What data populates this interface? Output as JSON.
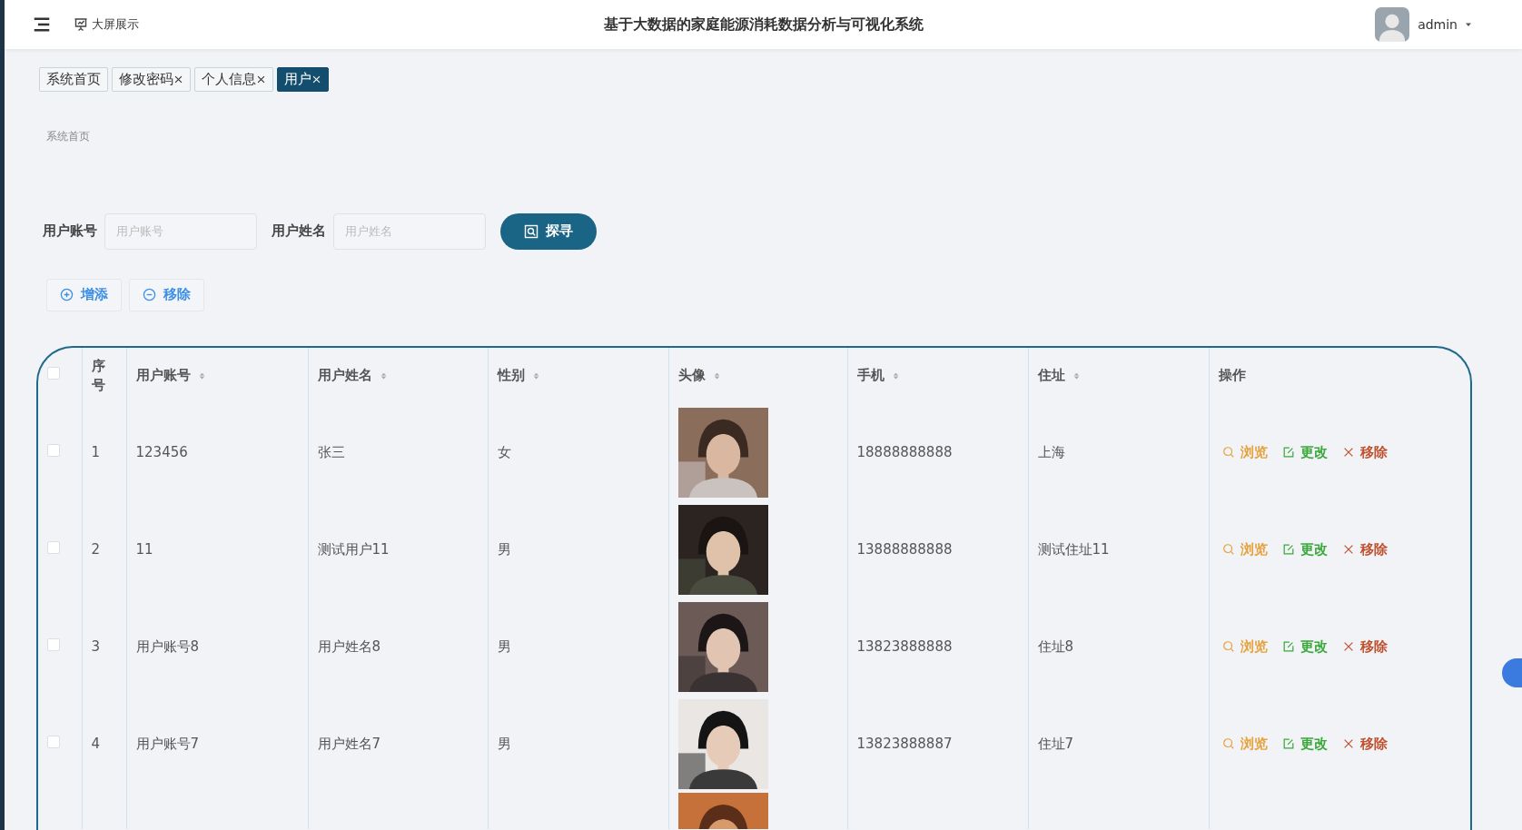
{
  "header": {
    "screen_link": "大屏展示",
    "title": "基于大数据的家庭能源消耗数据分析与可视化系统",
    "user": "admin"
  },
  "tabs": [
    {
      "label": "系统首页",
      "closable": false,
      "selected": false
    },
    {
      "label": "修改密码",
      "closable": true,
      "selected": false
    },
    {
      "label": "个人信息",
      "closable": true,
      "selected": false
    },
    {
      "label": "用户",
      "closable": true,
      "selected": true
    }
  ],
  "breadcrumb": "系统首页",
  "search": {
    "fields": [
      {
        "label": "用户账号",
        "placeholder": "用户账号"
      },
      {
        "label": "用户姓名",
        "placeholder": "用户姓名"
      }
    ],
    "button": "探寻"
  },
  "toolbar": [
    {
      "kind": "add",
      "label": "增添"
    },
    {
      "kind": "remove",
      "label": "移除"
    }
  ],
  "table": {
    "select_all_checked": false,
    "columns": [
      {
        "label": "序号",
        "sortable": false
      },
      {
        "label": "用户账号",
        "sortable": true
      },
      {
        "label": "用户姓名",
        "sortable": true
      },
      {
        "label": "性别",
        "sortable": true
      },
      {
        "label": "头像",
        "sortable": true
      },
      {
        "label": "手机",
        "sortable": true
      },
      {
        "label": "住址",
        "sortable": true
      },
      {
        "label": "操作",
        "sortable": false
      }
    ],
    "rows": [
      {
        "index": "1",
        "account": "123456",
        "name": "张三",
        "gender": "女",
        "avatar": {
          "kind": "picture"
        },
        "phone": "18888888888",
        "address": "上海",
        "checked": false,
        "actions": [
          {
            "kind": "view",
            "label": "浏览"
          },
          {
            "kind": "edit",
            "label": "更改"
          },
          {
            "kind": "delete",
            "label": "移除"
          }
        ]
      },
      {
        "index": "2",
        "account": "11",
        "name": "测试用户11",
        "gender": "男",
        "avatar": {
          "kind": "picture"
        },
        "phone": "13888888888",
        "address": "测试住址11",
        "checked": false,
        "actions": [
          {
            "kind": "view",
            "label": "浏览"
          },
          {
            "kind": "edit",
            "label": "更改"
          },
          {
            "kind": "delete",
            "label": "移除"
          }
        ]
      },
      {
        "index": "3",
        "account": "用户账号8",
        "name": "用户姓名8",
        "gender": "男",
        "avatar": {
          "kind": "picture"
        },
        "phone": "13823888888",
        "address": "住址8",
        "checked": false,
        "actions": [
          {
            "kind": "view",
            "label": "浏览"
          },
          {
            "kind": "edit",
            "label": "更改"
          },
          {
            "kind": "delete",
            "label": "移除"
          }
        ]
      },
      {
        "index": "4",
        "account": "用户账号7",
        "name": "用户姓名7",
        "gender": "男",
        "avatar": {
          "kind": "picture"
        },
        "phone": "13823888887",
        "address": "住址7",
        "checked": false,
        "actions": [
          {
            "kind": "view",
            "label": "浏览"
          },
          {
            "kind": "edit",
            "label": "更改"
          },
          {
            "kind": "delete",
            "label": "移除"
          }
        ]
      }
    ],
    "partial_row": {
      "avatar": {
        "kind": "picture"
      }
    }
  }
}
